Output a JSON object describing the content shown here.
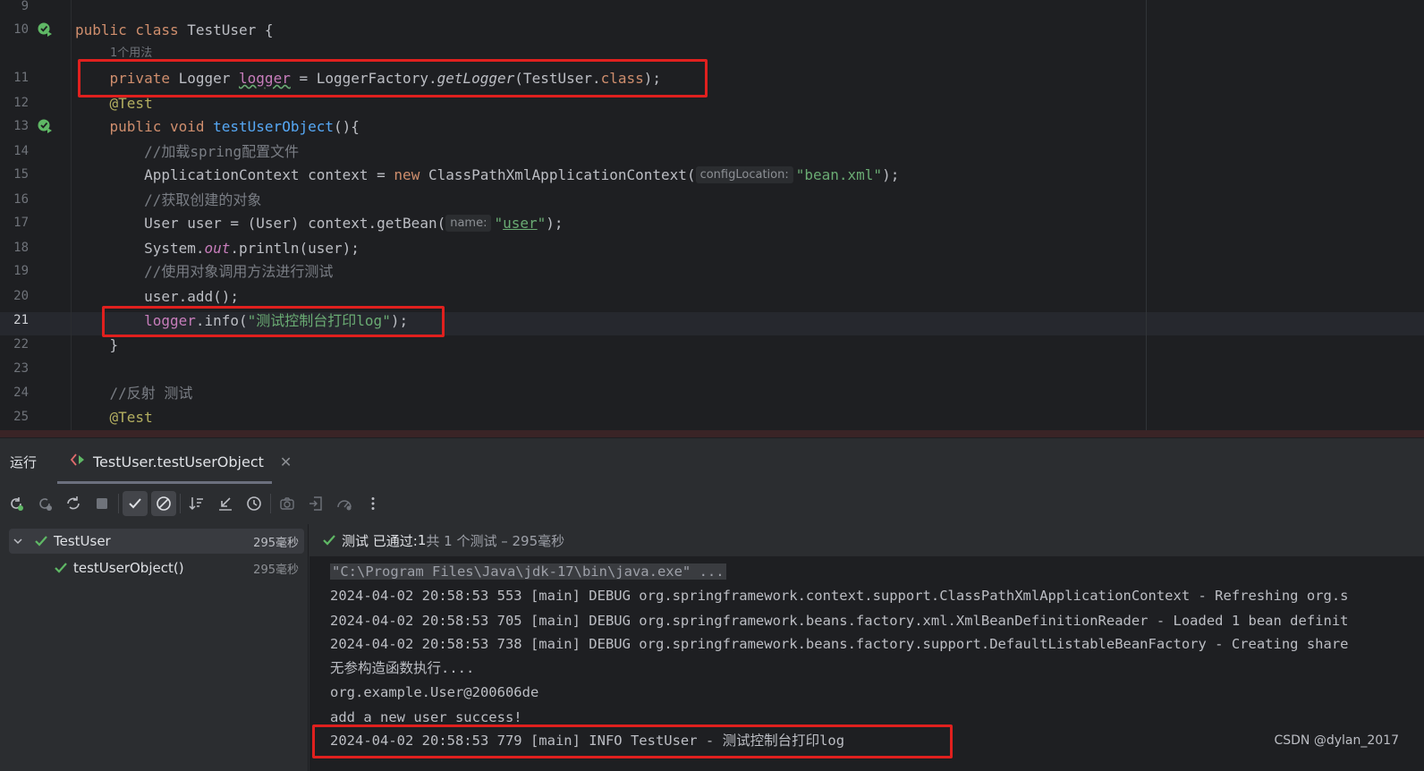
{
  "editor": {
    "lines": [
      {
        "num": "9"
      },
      {
        "num": "10"
      },
      {
        "num": "11"
      },
      {
        "num": "12"
      },
      {
        "num": "13"
      },
      {
        "num": "14"
      },
      {
        "num": "15"
      },
      {
        "num": "16"
      },
      {
        "num": "17"
      },
      {
        "num": "18"
      },
      {
        "num": "19"
      },
      {
        "num": "20"
      },
      {
        "num": "21"
      },
      {
        "num": "22"
      },
      {
        "num": "23"
      },
      {
        "num": "24"
      },
      {
        "num": "25"
      }
    ],
    "usage_hint": "1个用法",
    "hint_config_location": "configLocation:",
    "hint_name": "name:",
    "comment_load_config": "//加载spring配置文件",
    "comment_get_object": "//获取创建的对象",
    "comment_invoke": "//使用对象调用方法进行测试",
    "comment_reflection": "//反射 测试",
    "string_bean_xml": "\"bean.xml\"",
    "string_user": "user",
    "string_log": "\"测试控制台打印log\""
  },
  "run_window": {
    "title": "运行",
    "tab_label": "TestUser.testUserObject",
    "tree": [
      {
        "label": "TestUser",
        "time": "295毫秒"
      },
      {
        "label": "testUserObject()",
        "time": "295毫秒"
      }
    ],
    "status": {
      "prefix": "测试 已通过: ",
      "count": "1",
      "suffix": "共 1 个测试 – 295毫秒"
    },
    "console_lines": [
      "\"C:\\Program Files\\Java\\jdk-17\\bin\\java.exe\" ...",
      "2024-04-02 20:58:53 553 [main] DEBUG org.springframework.context.support.ClassPathXmlApplicationContext - Refreshing org.s",
      "2024-04-02 20:58:53 705 [main] DEBUG org.springframework.beans.factory.xml.XmlBeanDefinitionReader - Loaded 1 bean definit",
      "2024-04-02 20:58:53 738 [main] DEBUG org.springframework.beans.factory.support.DefaultListableBeanFactory - Creating share",
      "无参构造函数执行....",
      "org.example.User@200606de",
      "add a new user success!",
      "2024-04-02 20:58:53 779 [main] INFO TestUser - 测试控制台打印log"
    ]
  },
  "watermark": "CSDN @dylan_2017",
  "colors": {
    "highlight_box": "#e0201e",
    "pass_green": "#5fb865",
    "keyword": "#cf8e6d",
    "string": "#6aab73"
  }
}
